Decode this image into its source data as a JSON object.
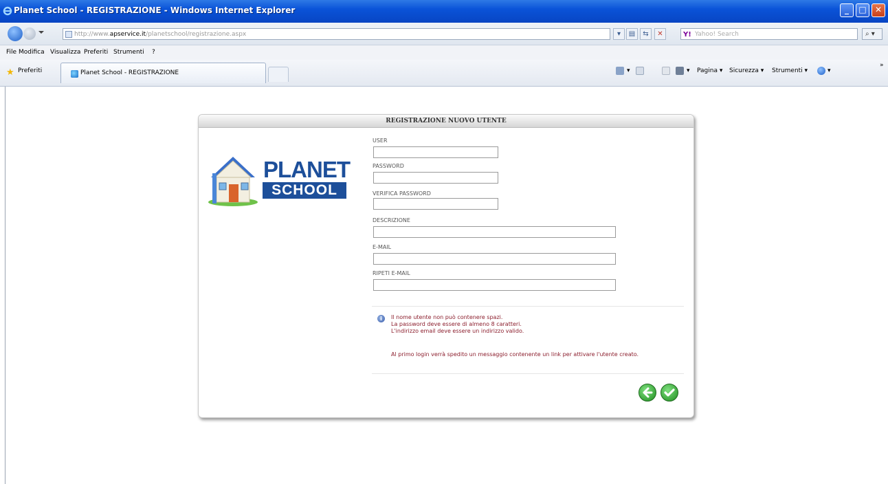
{
  "window": {
    "title": "Planet School - REGISTRAZIONE - Windows Internet Explorer"
  },
  "address_bar": {
    "url_prefix": "http://www.",
    "url_domain": "apservice.it",
    "url_rest": "/planetschool/registrazione.aspx",
    "search_placeholder": "Yahoo! Search"
  },
  "menu": [
    "File",
    "Modifica",
    "Visualizza",
    "Preferiti",
    "Strumenti",
    "?"
  ],
  "favorites": {
    "label": "Preferiti",
    "tab_title": "Planet School - REGISTRAZIONE"
  },
  "command_bar": {
    "page": "Pagina",
    "security": "Sicurezza",
    "tools": "Strumenti"
  },
  "form": {
    "header": "REGISTRAZIONE NUOVO UTENTE",
    "logo_line1": "PLANET",
    "logo_line2": "SCHOOL",
    "fields": {
      "user": "USER",
      "password": "PASSWORD",
      "verify_password": "VERIFICA PASSWORD",
      "description": "DESCRIZIONE",
      "email": "E-MAIL",
      "repeat_email": "RIPETI E-MAIL"
    },
    "messages": [
      "Il nome utente non può contenere spazi.",
      "La password deve essere di almeno 8 caratteri.",
      "L'indirizzo email deve essere un indirizzo valido."
    ],
    "note": "Al primo login verrà spedito un messaggio contenente un link per attivare l'utente creato."
  },
  "colors": {
    "titlebar": "#0a53d8",
    "message_text": "#8b1d2c",
    "logo_blue": "#1d4f9a",
    "button_green": "#1f8d1f"
  }
}
